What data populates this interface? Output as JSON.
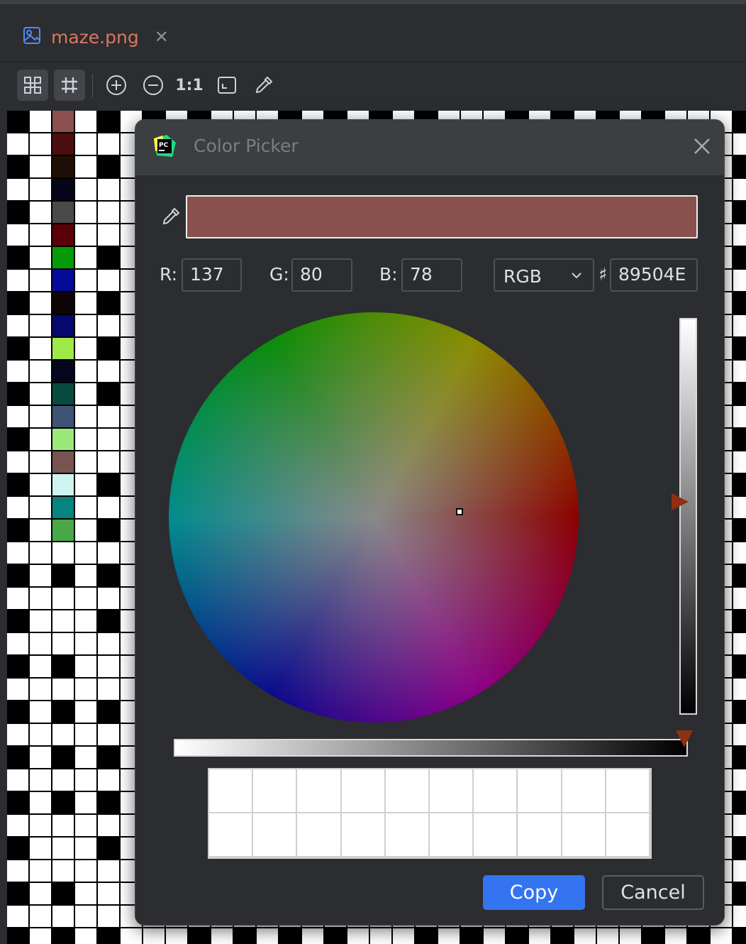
{
  "tab": {
    "filename": "maze.png",
    "icon": "image-file-icon",
    "close_icon": "close-icon"
  },
  "toolbar": {
    "actual_size_label": "1:1",
    "buttons": [
      "chessboard-icon",
      "grid-icon",
      "zoom-in-icon",
      "zoom-out-icon",
      "actual-size",
      "fit-icon",
      "color-picker-icon"
    ]
  },
  "dialog": {
    "title": "Color Picker",
    "r_label": "R:",
    "r_value": "137",
    "g_label": "G:",
    "g_value": "80",
    "b_label": "B:",
    "b_value": "78",
    "mode": "RGB",
    "hash_label": "♯",
    "hex_value": "89504E",
    "preview_color": "#89504E",
    "copy_label": "Copy",
    "cancel_label": "Cancel"
  },
  "colors": {
    "accent": "#3574f0",
    "tab_text": "#d9785f",
    "slider_arrow": "#8f3010"
  },
  "maze_left_column_colors": [
    "#8c5050",
    "#4a0e0e",
    "#1e0f06",
    "#06061a",
    "#4a4a48",
    "#5a0008",
    "#069a08",
    "#060a9a",
    "#0e0606",
    "#06086e",
    "#9ee84a",
    "#06061e",
    "#064a40",
    "#3e5272",
    "#9aea7a",
    "#785450",
    "#cef4f0",
    "#068480",
    "#48a848"
  ]
}
